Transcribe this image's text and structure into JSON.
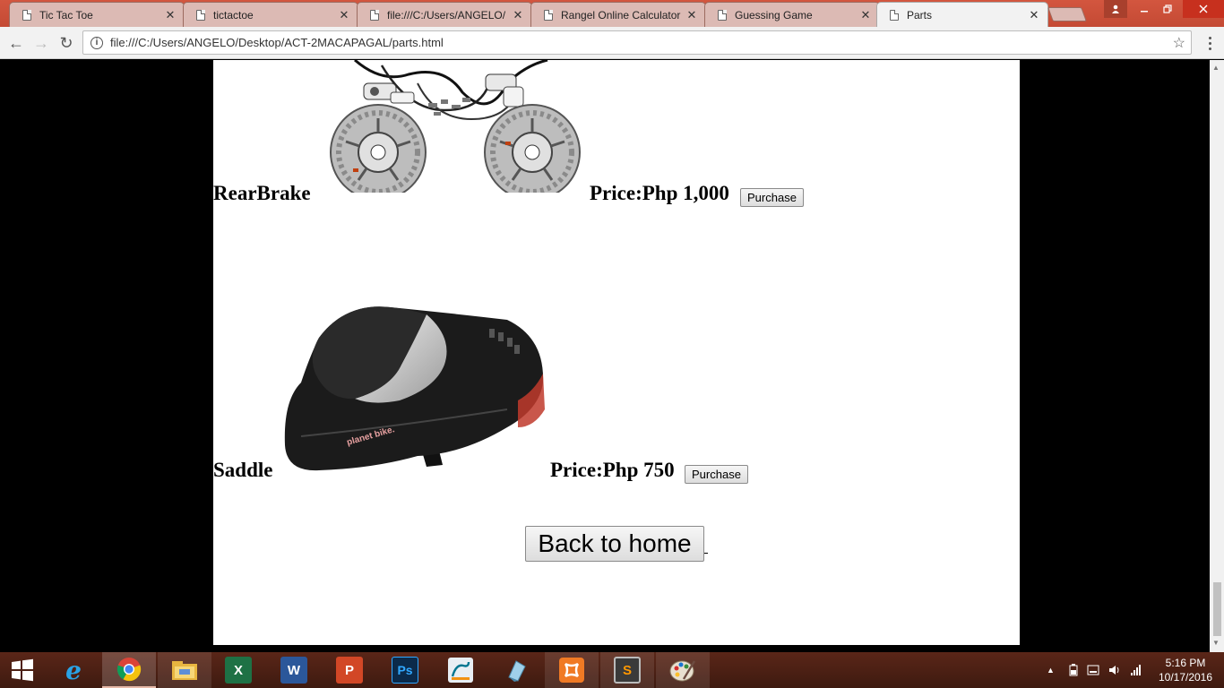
{
  "browser": {
    "tabs": [
      {
        "title": "Tic Tac Toe",
        "active": false
      },
      {
        "title": "tictactoe",
        "active": false
      },
      {
        "title": "file:///C:/Users/ANGELO/",
        "active": false
      },
      {
        "title": "Rangel Online Calculator",
        "active": false
      },
      {
        "title": "Guessing Game",
        "active": false
      },
      {
        "title": "Parts",
        "active": true
      }
    ],
    "close_glyph": "✕",
    "url": "file:///C:/Users/ANGELO/Desktop/ACT-2MACAPAGAL/parts.html",
    "icons": {
      "back": "←",
      "forward": "→",
      "reload": "↻",
      "info": "i",
      "star": "☆"
    }
  },
  "page": {
    "parts": [
      {
        "name": "RearBrake",
        "price": "Price:Php 1,000",
        "button": "Purchase",
        "image": "hydraulic-disc-brake-set"
      },
      {
        "name": "Saddle",
        "price": "Price:Php 750",
        "button": "Purchase",
        "image": "planet-bike-saddle"
      }
    ],
    "saddle_logo": "planet bike.",
    "home_button": "Back to home"
  },
  "taskbar": {
    "apps": [
      {
        "name": "internet-explorer",
        "glyph": "e",
        "color": "#1a8fd8"
      },
      {
        "name": "chrome",
        "glyph": "",
        "color": "#db4437"
      },
      {
        "name": "file-explorer",
        "glyph": "",
        "color": "#f0c040"
      },
      {
        "name": "excel",
        "glyph": "X",
        "color": "#1e7145"
      },
      {
        "name": "word",
        "glyph": "W",
        "color": "#2b579a"
      },
      {
        "name": "powerpoint",
        "glyph": "P",
        "color": "#d24726"
      },
      {
        "name": "photoshop",
        "glyph": "Ps",
        "color": "#0b2a4a"
      },
      {
        "name": "mysql-installer",
        "glyph": "",
        "color": "#e8e8e8"
      },
      {
        "name": "notepad-app",
        "glyph": "",
        "color": "#7ab6d6"
      },
      {
        "name": "xampp",
        "glyph": "",
        "color": "#f07a24"
      },
      {
        "name": "sublime-text",
        "glyph": "S",
        "color": "#4a4a4a"
      },
      {
        "name": "paint",
        "glyph": "",
        "color": "#c8c8c8"
      }
    ],
    "time": "5:16 PM",
    "date": "10/17/2016"
  }
}
